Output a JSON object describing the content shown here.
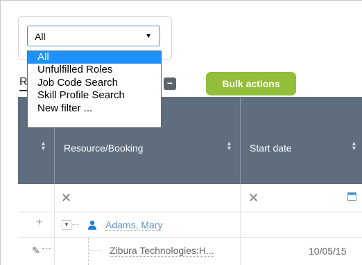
{
  "filter": {
    "selected": "All",
    "options": [
      "All",
      "Unfulfilled Roles",
      "Job Code Search",
      "Skill Profile Search",
      "New filter ..."
    ]
  },
  "toolbar": {
    "tab_label": "R",
    "collapse_symbol": "−",
    "bulk_actions_label": "Bulk actions"
  },
  "grid": {
    "columns": [
      "Resource/Booking",
      "Start date"
    ],
    "filter_clear_symbol": "✕",
    "rows": [
      {
        "type": "resource",
        "name": "Adams, Mary",
        "add_symbol": "+"
      },
      {
        "type": "booking",
        "name": "Zibura Technologies:H...",
        "start_date": "10/05/15"
      }
    ]
  },
  "colors": {
    "header_bg": "#5e6e7f",
    "bulk_button": "#93be3a",
    "selected_option": "#1e90ff",
    "link": "#5e8fc7"
  }
}
